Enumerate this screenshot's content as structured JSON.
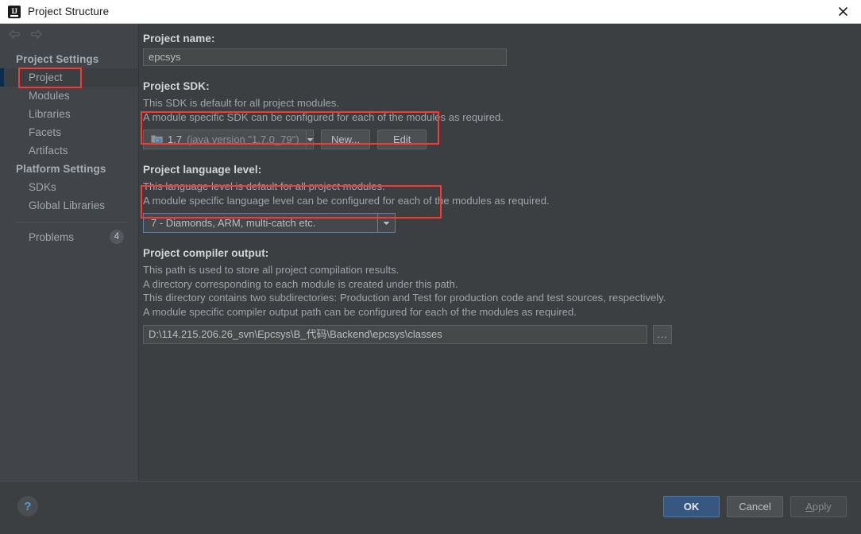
{
  "window": {
    "title": "Project Structure",
    "app_icon": "intellij-idea-icon",
    "close_icon": "close-icon"
  },
  "sidebar": {
    "nav_back_icon": "arrow-left-icon",
    "nav_forward_icon": "arrow-right-icon",
    "groups": [
      {
        "header": "Project Settings",
        "items": [
          {
            "label": "Project",
            "selected": true
          },
          {
            "label": "Modules",
            "selected": false
          },
          {
            "label": "Libraries",
            "selected": false
          },
          {
            "label": "Facets",
            "selected": false
          },
          {
            "label": "Artifacts",
            "selected": false
          }
        ]
      },
      {
        "header": "Platform Settings",
        "items": [
          {
            "label": "SDKs",
            "selected": false
          },
          {
            "label": "Global Libraries",
            "selected": false
          }
        ]
      }
    ],
    "problems": {
      "label": "Problems",
      "count": "4"
    }
  },
  "main": {
    "project_name": {
      "label": "Project name:",
      "value": "epcsys",
      "placeholder": "Project name"
    },
    "project_sdk": {
      "label": "Project SDK:",
      "desc_line1": "This SDK is default for all project modules.",
      "desc_line2": "A module specific SDK can be configured for each of the modules as required.",
      "sdk_icon": "java-sdk-folder-icon",
      "value_name": "1.7",
      "value_detail": "(java version \"1.7.0_79\")",
      "dropdown_icon": "chevron-down-icon",
      "new_button": "New...",
      "new_button_mnemonic": "N",
      "edit_button": "Edit",
      "edit_button_mnemonic": "E"
    },
    "language_level": {
      "label": "Project language level:",
      "desc_line1": "This language level is default for all project modules.",
      "desc_line2": "A module specific language level can be configured for each of the modules as required.",
      "value": "7 - Diamonds, ARM, multi-catch etc.",
      "dropdown_icon": "chevron-down-icon"
    },
    "compiler_output": {
      "label": "Project compiler output:",
      "desc_line1": "This path is used to store all project compilation results.",
      "desc_line2": "A directory corresponding to each module is created under this path.",
      "desc_line3": "This directory contains two subdirectories: Production and Test for production code and test sources, respectively.",
      "desc_line4": "A module specific compiler output path can be configured for each of the modules as required.",
      "value": "D:\\114.215.206.26_svn\\Epcsys\\B_代码\\Backend\\epcsys\\classes",
      "browse_button": "...",
      "browse_icon": "ellipsis-browse-icon"
    }
  },
  "footer": {
    "help_icon": "help-question-icon",
    "help_label": "?",
    "ok_button": "OK",
    "cancel_button": "Cancel",
    "apply_button": "Apply",
    "apply_mnemonic": "A"
  },
  "annotations": {
    "highlight_color": "#fc3832",
    "boxes": [
      "project-sidebar-item",
      "project-sdk-row",
      "language-level-row"
    ]
  },
  "colors": {
    "titlebar_bg": "#ffffff",
    "sidebar_bg": "#41454a",
    "content_bg": "#3c3f41",
    "accent_blue": "#365880",
    "focus_blue": "#5781b4",
    "annotation_red": "#fc3832",
    "selection_bar": "#0d2c4b"
  }
}
